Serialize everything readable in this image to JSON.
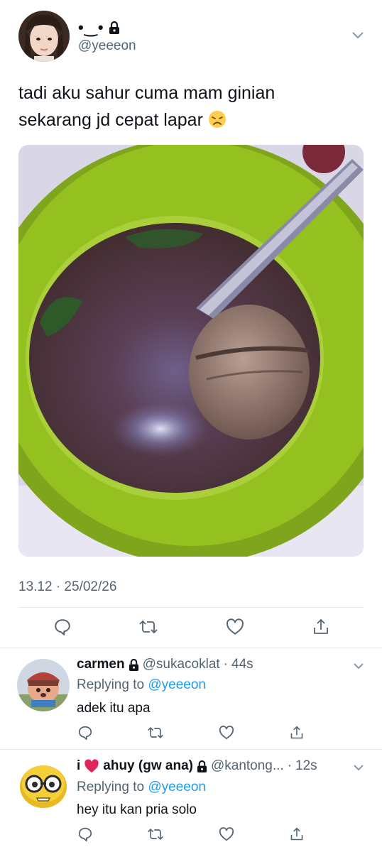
{
  "tweet": {
    "display_name": "•‿•",
    "handle": "@yeeeon",
    "text_line1": "tadi aku sahur cuma mam ginian",
    "text_line2": "sekarang jd cepat lapar",
    "emoji": "disappointed-face",
    "media_description": "bowl of bakso meatball soup",
    "timestamp": "13.12 · 25/02/26",
    "actions": [
      "reply",
      "retweet",
      "like",
      "share"
    ]
  },
  "replies": [
    {
      "display_name": "carmen",
      "protected": true,
      "handle": "@sukacoklat",
      "time": "44s",
      "replying_label": "Replying to",
      "replying_to": "@yeeeon",
      "text": "adek itu apa"
    },
    {
      "display_name_prefix": "i",
      "display_name_emoji": "red-heart",
      "display_name": "ahuy (gw ana)",
      "protected": true,
      "handle": "@kantong...",
      "time": "12s",
      "replying_label": "Replying to",
      "replying_to": "@yeeeon",
      "text": "hey itu kan pria solo"
    }
  ],
  "colors": {
    "text_primary": "#0f1419",
    "text_secondary": "#536471",
    "link": "#1d9bf0",
    "divider": "#e6ecf0"
  }
}
